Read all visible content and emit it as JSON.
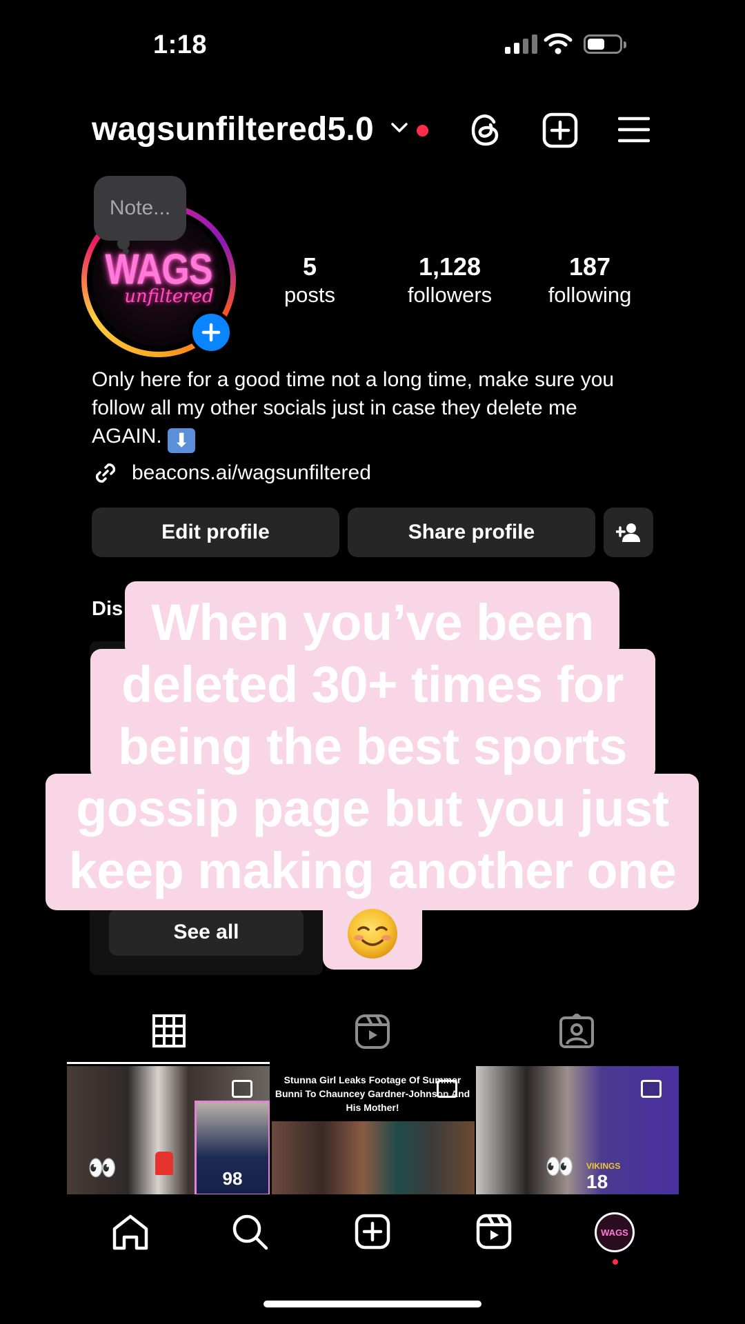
{
  "status_bar": {
    "time": "1:18"
  },
  "header": {
    "username": "wagsunfiltered5.0"
  },
  "profile": {
    "note": "Note...",
    "logo_main": "WAGS",
    "logo_script": "unfiltered",
    "stats": [
      {
        "value": "5",
        "label": "posts"
      },
      {
        "value": "1,128",
        "label": "followers"
      },
      {
        "value": "187",
        "label": "following"
      }
    ],
    "bio": "Only here for a good time not a long time, make sure you follow all my other socials just in case they delete me AGAIN.",
    "bio_emoji": "⬇",
    "link": "beacons.ai/wagsunfiltered"
  },
  "buttons": {
    "edit": "Edit profile",
    "share": "Share profile"
  },
  "discover": {
    "title_visible": "Dis",
    "see_all": "See all"
  },
  "overlay": {
    "lines": [
      "When you’ve been",
      "deleted 30+ times for",
      "being the best sports",
      "gossip page but you just",
      "keep making another one"
    ]
  },
  "grid": {
    "post2_headline": "Stunna Girl Leaks Footage Of Summer Bunni To Chauncey Gardner-Johnson And His Mother!",
    "post1_jersey": "98",
    "post3_jersey": "18",
    "post3_team": "VIKINGS"
  },
  "nav": {
    "avatar_label": "WAGS"
  },
  "colors": {
    "accent_blue": "#0a84ff",
    "notification_red": "#ff2d48",
    "overlay_pink": "#f8d6e6",
    "button_bg": "#262626"
  }
}
